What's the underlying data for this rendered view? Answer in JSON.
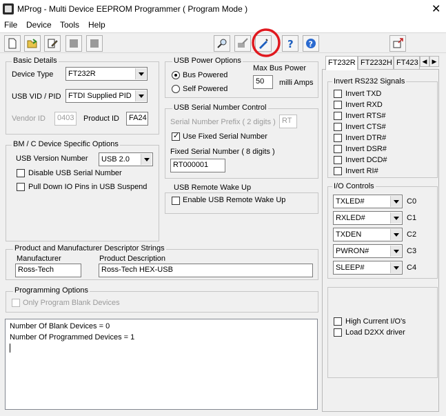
{
  "window": {
    "title": "MProg - Multi Device EEPROM Programmer ( Program Mode )"
  },
  "menu": [
    "File",
    "Device",
    "Tools",
    "Help"
  ],
  "toolbar": {
    "buttons": [
      "new-file-icon",
      "open-folder-icon",
      "edit-icon",
      "stop-icon",
      "stop-icon",
      "search-icon",
      "program-icon",
      "program-device-icon",
      "help-icon",
      "about-icon",
      "exit-icon"
    ]
  },
  "basic": {
    "title": "Basic Details",
    "device_type_label": "Device Type",
    "device_type": "FT232R",
    "vidpid_label": "USB VID / PID",
    "vidpid": "FTDI Supplied PID",
    "vendor_label": "Vendor ID",
    "vendor": "0403",
    "product_label": "Product ID",
    "product": "FA24"
  },
  "power": {
    "title": "USB Power Options",
    "bus": "Bus Powered",
    "self": "Self Powered",
    "max_label": "Max Bus Power",
    "max_value": "50",
    "unit": "milli Amps"
  },
  "serial": {
    "title": "USB Serial Number Control",
    "prefix_label": "Serial Number Prefix ( 2 digits )",
    "prefix": "RT",
    "use_fixed": "Use Fixed Serial Number",
    "fixed_label": "Fixed Serial Number ( 8 digits )",
    "fixed": "RT000001"
  },
  "bm": {
    "title": "BM / C Device Specific Options",
    "usb_version_label": "USB Version Number",
    "usb_version": "USB 2.0",
    "disable_serial": "Disable USB Serial Number",
    "pull_down": "Pull Down IO Pins in USB Suspend"
  },
  "wake": {
    "title": "USB Remote Wake Up",
    "enable": "Enable USB Remote Wake Up"
  },
  "strings": {
    "title": "Product and Manufacturer Descriptor Strings",
    "manufacturer_label": "Manufacturer",
    "manufacturer": "Ross-Tech",
    "description_label": "Product Description",
    "description": "Ross-Tech HEX-USB"
  },
  "prog": {
    "title": "Programming Options",
    "blank_only": "Only Program Blank Devices"
  },
  "log": {
    "line1": "Number Of Blank Devices = 0",
    "line2": "Number Of Programmed Devices = 1"
  },
  "tabs": [
    "FT232R",
    "FT2232H",
    "FT423"
  ],
  "invert": {
    "title": "Invert RS232 Signals",
    "items": [
      "Invert TXD",
      "Invert RXD",
      "Invert RTS#",
      "Invert CTS#",
      "Invert DTR#",
      "Invert DSR#",
      "Invert DCD#",
      "Invert RI#"
    ]
  },
  "io": {
    "title": "I/O Controls",
    "rows": [
      {
        "value": "TXLED#",
        "label": "C0"
      },
      {
        "value": "RXLED#",
        "label": "C1"
      },
      {
        "value": "TXDEN",
        "label": "C2"
      },
      {
        "value": "PWRON#",
        "label": "C3"
      },
      {
        "value": "SLEEP#",
        "label": "C4"
      }
    ]
  },
  "extra": {
    "high_current": "High Current I/O's",
    "load_d2xx": "Load D2XX driver"
  },
  "colors": {
    "highlight": "#e0191f",
    "toolbar_blue": "#1e5fbf"
  }
}
